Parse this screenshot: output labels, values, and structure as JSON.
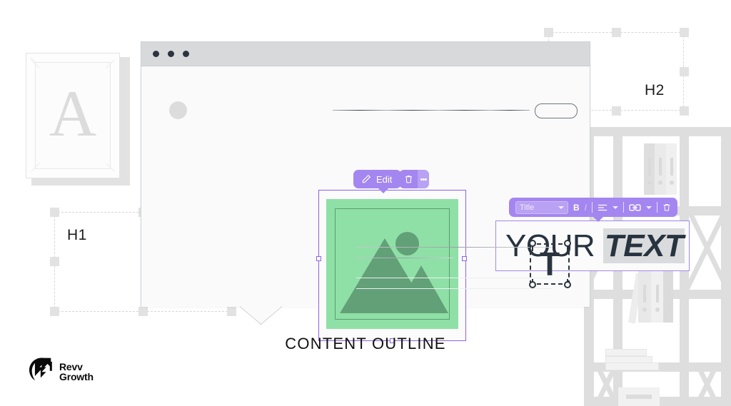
{
  "page": {
    "caption": "CONTENT OUTLINE",
    "background_color": "#ffffff"
  },
  "logo": {
    "name": "revv-growth-logo",
    "line1": "Revv",
    "line2": "Growth",
    "mark": "g-arrow-mark"
  },
  "decor": {
    "picture_frame": {
      "letter": "A"
    },
    "bookshelf": {
      "name": "bookshelf-illustration"
    }
  },
  "outline_markers": [
    {
      "label": "H1"
    },
    {
      "label": "H2"
    }
  ],
  "browser": {
    "title_bar": {
      "dots": 3
    },
    "header": {
      "avatar": "user-avatar",
      "nav_links": 4,
      "cta_button": ""
    },
    "image_block": {
      "toolbar": {
        "edit_label": "Edit",
        "edit_icon": "pencil-icon",
        "delete_icon": "trash-icon",
        "more_icon": "kebab-menu-icon"
      },
      "placeholder": "image-placeholder"
    },
    "text_block": {
      "toolbar": {
        "style_select_value": "Title",
        "bold_label": "B",
        "italic_label": "I",
        "align_icon": "align-left-icon",
        "link_icon": "link-icon",
        "delete_icon": "trash-icon"
      },
      "text_plain": "YOUR ",
      "text_highlight": "TEXT"
    },
    "body_lines": 4,
    "t_element": {
      "glyph": "T"
    }
  },
  "colors": {
    "accent_purple": "#a486f0",
    "accent_purple_light": "#b9a1f3",
    "image_green": "#8fe0a6",
    "image_green_dark": "#62a077",
    "ink": "#2c3440",
    "chrome_gray": "#d7d9da",
    "dash_gray": "#d6d6d6"
  }
}
